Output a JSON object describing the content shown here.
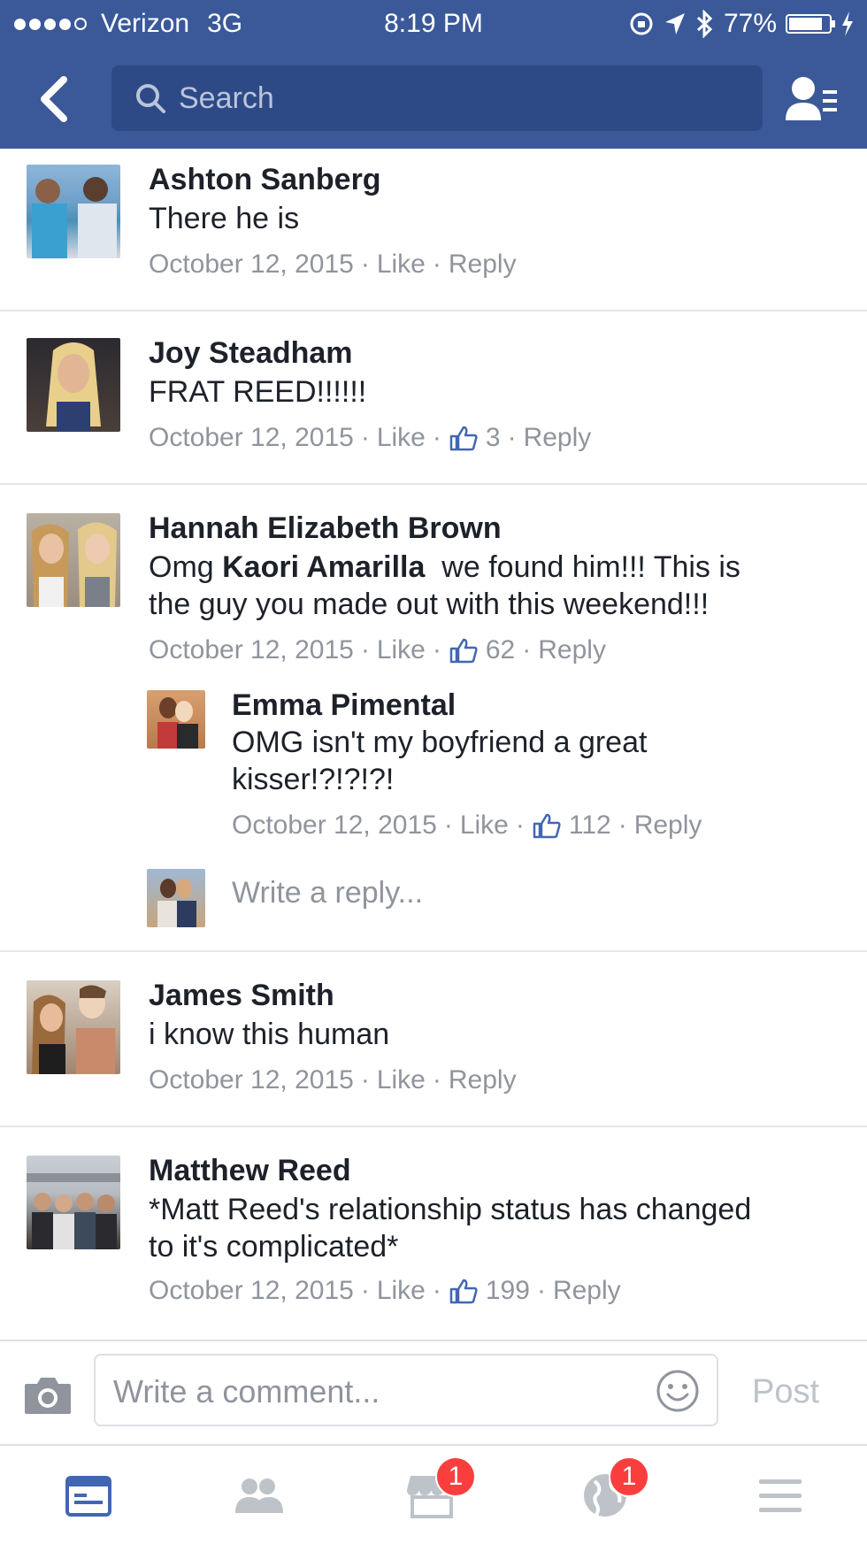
{
  "status_bar": {
    "carrier": "Verizon",
    "network": "3G",
    "time": "8:19 PM",
    "battery": "77%",
    "battery_level": 0.77,
    "signal_bars": 4
  },
  "nav": {
    "search_placeholder": "Search"
  },
  "comments": [
    {
      "name": "Ashton Sanberg",
      "text": "There he is",
      "date": "October 12, 2015",
      "like_label": "Like",
      "likes": "",
      "reply_label": "Reply"
    },
    {
      "name": "Joy Steadham",
      "text": "FRAT REED!!!!!!",
      "date": "October 12, 2015",
      "like_label": "Like",
      "likes": "3",
      "reply_label": "Reply"
    },
    {
      "name": "Hannah Elizabeth Brown",
      "text_prefix": "Omg ",
      "mention": "Kaori Amarilla",
      "text_line1_suffix": "  we found him!!! This is",
      "text_line2": "the guy you made out with this weekend!!!",
      "date": "October 12, 2015",
      "like_label": "Like",
      "likes": "62",
      "reply_label": "Reply"
    },
    {
      "name": "Emma Pimental",
      "text_line1": "OMG isn't my boyfriend a great",
      "text_line2": "kisser!?!?!?!",
      "date": "October 12, 2015",
      "like_label": "Like",
      "likes": "112",
      "reply_label": "Reply"
    },
    {
      "name": "James Smith",
      "text": "i know this human",
      "date": "October 12, 2015",
      "like_label": "Like",
      "likes": "",
      "reply_label": "Reply"
    },
    {
      "name": "Matthew Reed",
      "text_line1": "*Matt Reed's relationship status has changed",
      "text_line2": "to it's complicated*",
      "date": "October 12, 2015",
      "like_label": "Like",
      "likes": "199",
      "reply_label": "Reply"
    }
  ],
  "reply_box": {
    "placeholder": "Write a reply..."
  },
  "composer": {
    "placeholder": "Write a comment...",
    "post_label": "Post"
  },
  "tabbar": {
    "marketplace_badge": "1",
    "notifications_badge": "1"
  },
  "colors": {
    "brand": "#3b5998",
    "search_bg": "#2e4a86",
    "meta": "#90949c",
    "badge": "#fa3e3e",
    "active_tab": "#4267b2"
  },
  "icons": [
    "back-icon",
    "search-icon",
    "friend-requests-icon",
    "thumbs-up-icon",
    "camera-icon",
    "smiley-icon",
    "news-feed-icon",
    "friends-icon",
    "marketplace-icon",
    "globe-icon",
    "menu-icon"
  ]
}
